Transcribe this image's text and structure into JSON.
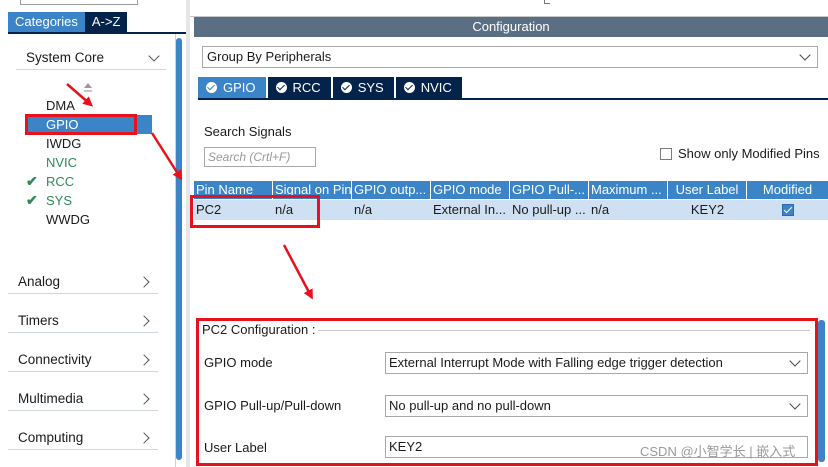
{
  "left_panel": {
    "tabs": [
      {
        "label": "Categories",
        "active": true
      },
      {
        "label": "A->Z",
        "active": false
      }
    ],
    "categories": [
      {
        "label": "System Core",
        "expanded": true
      },
      {
        "label": "Analog",
        "expanded": false
      },
      {
        "label": "Timers",
        "expanded": false
      },
      {
        "label": "Connectivity",
        "expanded": false
      },
      {
        "label": "Multimedia",
        "expanded": false
      },
      {
        "label": "Computing",
        "expanded": false
      }
    ],
    "system_core_items": [
      {
        "label": "DMA",
        "status": "none"
      },
      {
        "label": "GPIO",
        "status": "selected"
      },
      {
        "label": "IWDG",
        "status": "none"
      },
      {
        "label": "NVIC",
        "status": "available"
      },
      {
        "label": "RCC",
        "status": "configured"
      },
      {
        "label": "SYS",
        "status": "configured"
      },
      {
        "label": "WWDG",
        "status": "none"
      }
    ]
  },
  "right_panel": {
    "header": "Configuration",
    "group_select": "Group By Peripherals",
    "config_tabs": [
      {
        "label": "GPIO",
        "active": true
      },
      {
        "label": "RCC",
        "active": false
      },
      {
        "label": "SYS",
        "active": false
      },
      {
        "label": "NVIC",
        "active": false
      }
    ],
    "search_label": "Search Signals",
    "search_placeholder": "Search (Crtl+F)",
    "show_modified_label": "Show only Modified Pins",
    "table": {
      "columns": [
        "Pin Name",
        "Signal on Pin",
        "GPIO outp...",
        "GPIO mode",
        "GPIO Pull-...",
        "Maximum ...",
        "User Label",
        "Modified"
      ],
      "rows": [
        {
          "pin": "PC2",
          "signal": "n/a",
          "output": "n/a",
          "mode": "External In...",
          "pull": "No pull-up ...",
          "max": "n/a",
          "label": "KEY2",
          "modified": true
        }
      ]
    },
    "pin_config": {
      "title": "PC2 Configuration :",
      "fields": [
        {
          "label": "GPIO mode",
          "value": "External Interrupt Mode with Falling edge trigger detection",
          "type": "select"
        },
        {
          "label": "GPIO Pull-up/Pull-down",
          "value": "No pull-up and no pull-down",
          "type": "select"
        },
        {
          "label": "User Label",
          "value": "KEY2",
          "type": "input"
        }
      ]
    }
  },
  "watermark": "CSDN @小智学长 | 嵌入式",
  "colors": {
    "navy": "#03234b",
    "accent_blue": "#3c84c8",
    "header_gray": "#5a6e84",
    "annotation_red": "#e8121e",
    "configured_green": "#2e8b57"
  }
}
